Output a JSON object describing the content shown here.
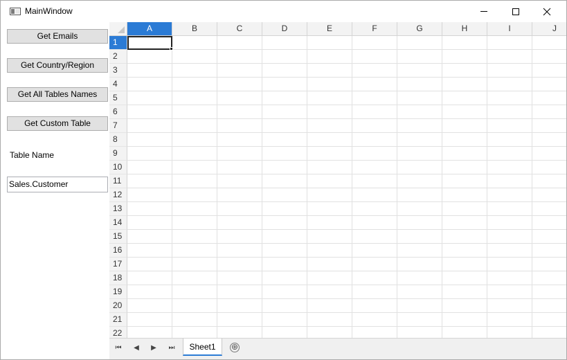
{
  "window": {
    "title": "MainWindow"
  },
  "left_panel": {
    "buttons": [
      {
        "label": "Get Emails"
      },
      {
        "label": "Get Country/Region"
      },
      {
        "label": "Get All Tables Names"
      },
      {
        "label": "Get Custom Table"
      }
    ],
    "table_name_label": "Table Name",
    "table_name_value": "Sales.Customer"
  },
  "spreadsheet": {
    "columns": [
      "A",
      "B",
      "C",
      "D",
      "E",
      "F",
      "G",
      "H",
      "I",
      "J"
    ],
    "rows": [
      "1",
      "2",
      "3",
      "4",
      "5",
      "6",
      "7",
      "8",
      "9",
      "10",
      "11",
      "12",
      "13",
      "14",
      "15",
      "16",
      "17",
      "18",
      "19",
      "20",
      "21",
      "22"
    ],
    "selected_column": "A",
    "selected_row": "1",
    "colors": {
      "selection": "#2b7bd5"
    }
  },
  "sheet_bar": {
    "tabs": [
      {
        "label": "Sheet1"
      }
    ],
    "nav_first": "⏮",
    "nav_prev": "◀",
    "nav_next": "▶",
    "nav_last": "⏭",
    "add_icon": "⊕"
  }
}
